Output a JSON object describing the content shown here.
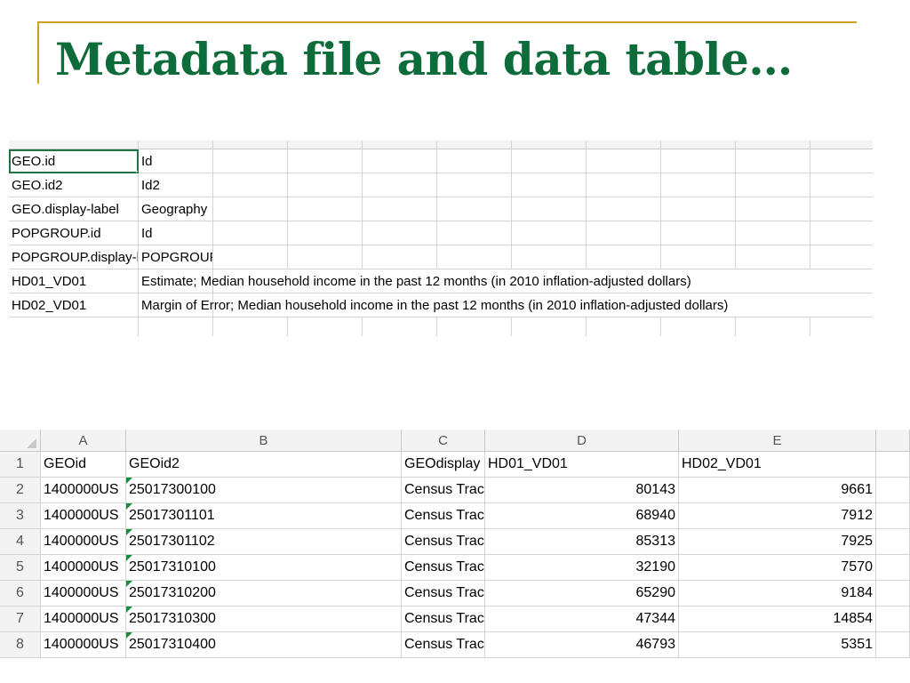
{
  "slide": {
    "title": "Metadata file and data table…"
  },
  "metadata_sheet": {
    "rows": [
      {
        "field": "GEO.id",
        "description": "Id"
      },
      {
        "field": "GEO.id2",
        "description": "Id2"
      },
      {
        "field": "GEO.display-label",
        "description": "Geography"
      },
      {
        "field": "POPGROUP.id",
        "description": "Id"
      },
      {
        "field": "POPGROUP.display-label",
        "description": "POPGROUP"
      },
      {
        "field": "HD01_VD01",
        "description": "Estimate; Median household income in the past 12 months (in 2010 inflation-adjusted dollars)"
      },
      {
        "field": "HD02_VD01",
        "description": "Margin of Error; Median household income in the past 12 months (in 2010 inflation-adjusted dollars)"
      }
    ]
  },
  "data_sheet": {
    "column_letters": [
      "A",
      "B",
      "C",
      "D",
      "E"
    ],
    "header_row": {
      "number": "1",
      "cells": [
        "GEOid",
        "GEOid2",
        "GEOdisplay",
        "HD01_VD01",
        "HD02_VD01"
      ]
    },
    "rows": [
      {
        "number": "2",
        "geoid": "1400000US",
        "geoid2": "25017300100",
        "display": "Census Tract",
        "hd01": "80143",
        "hd02": "9661"
      },
      {
        "number": "3",
        "geoid": "1400000US",
        "geoid2": "25017301101",
        "display": "Census Tract",
        "hd01": "68940",
        "hd02": "7912"
      },
      {
        "number": "4",
        "geoid": "1400000US",
        "geoid2": "25017301102",
        "display": "Census Tract",
        "hd01": "85313",
        "hd02": "7925"
      },
      {
        "number": "5",
        "geoid": "1400000US",
        "geoid2": "25017310100",
        "display": "Census Tract",
        "hd01": "32190",
        "hd02": "7570"
      },
      {
        "number": "6",
        "geoid": "1400000US",
        "geoid2": "25017310200",
        "display": "Census Tract",
        "hd01": "65290",
        "hd02": "9184"
      },
      {
        "number": "7",
        "geoid": "1400000US",
        "geoid2": "25017310300",
        "display": "Census Tract",
        "hd01": "47344",
        "hd02": "14854"
      },
      {
        "number": "8",
        "geoid": "1400000US",
        "geoid2": "25017310400",
        "display": "Census Tract",
        "hd01": "46793",
        "hd02": "5351"
      }
    ]
  }
}
